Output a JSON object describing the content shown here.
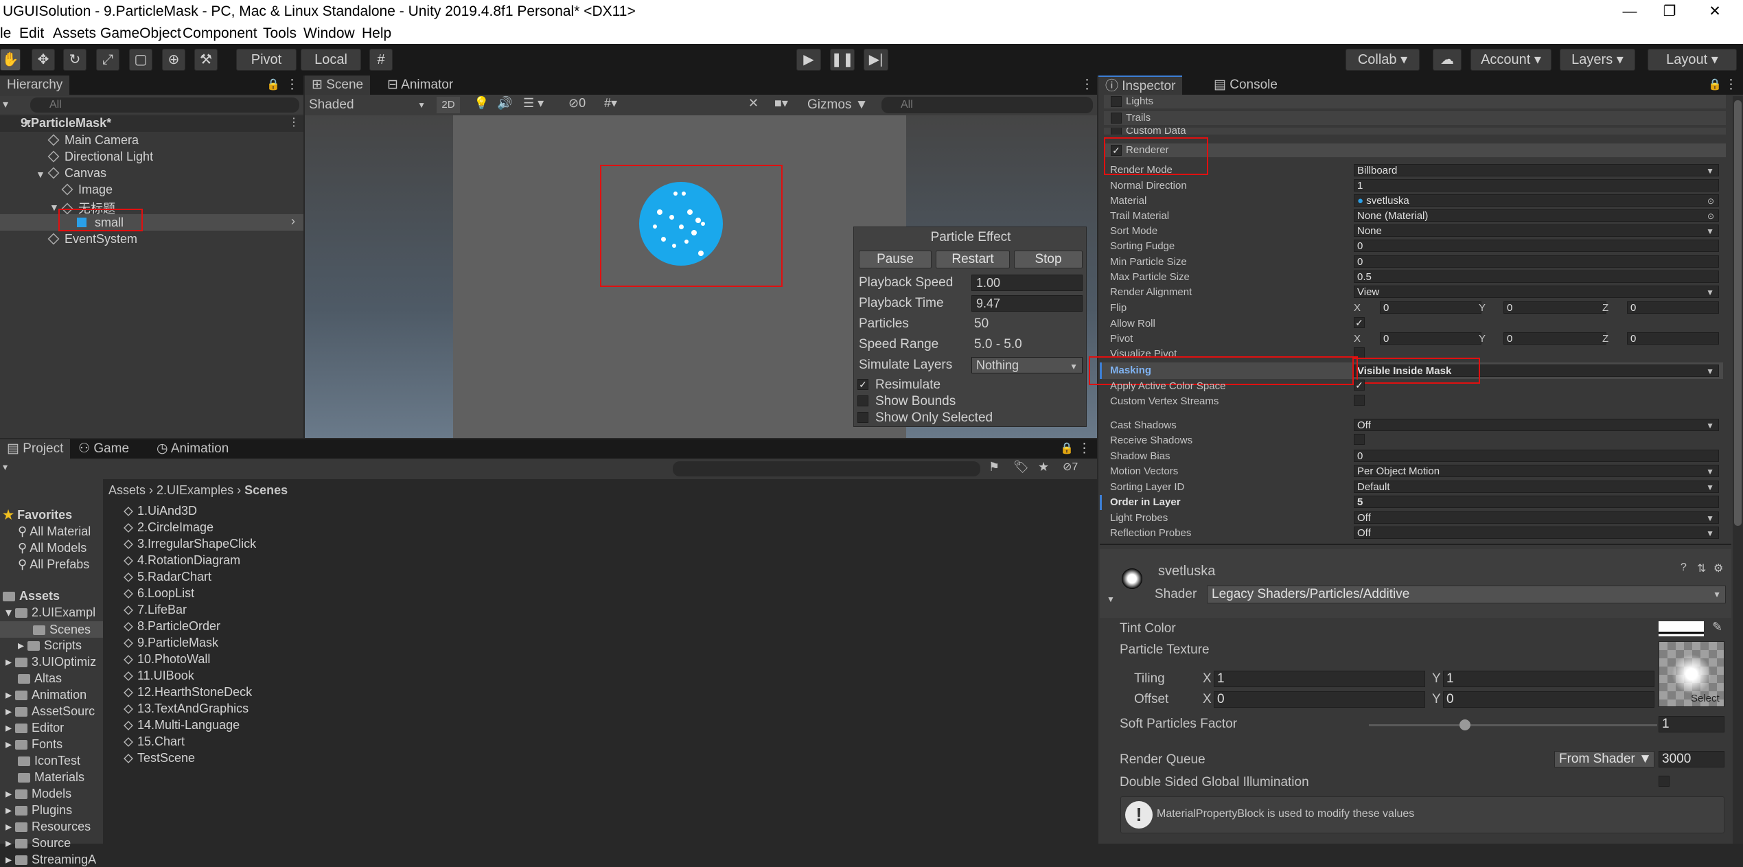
{
  "window": {
    "title": "UGUISolution - 9.ParticleMask - PC, Mac & Linux Standalone - Unity 2019.4.8f1 Personal* <DX11>",
    "minimize": "—",
    "maximize": "❐",
    "close": "✕"
  },
  "menu": [
    "le",
    "Edit",
    "Assets",
    "GameObject",
    "Component",
    "Tools",
    "Window",
    "Help"
  ],
  "toolbar": {
    "pivot_label": "Pivot",
    "local_label": "Local",
    "collab_label": "Collab",
    "account_label": "Account",
    "layers_label": "Layers",
    "layout_label": "Layout"
  },
  "hierarchy": {
    "tab": "Hierarchy",
    "search_placeholder": "All",
    "scene": "9.ParticleMask*",
    "items": [
      "Main Camera",
      "Directional Light",
      "Canvas",
      "Image",
      "无标题",
      "small",
      "EventSystem"
    ]
  },
  "scene_view": {
    "tabs": [
      "Scene",
      "Animator"
    ],
    "shading": "Shaded",
    "mode_2d": "2D",
    "hidden_count": "0",
    "gizmos": "Gizmos",
    "search_placeholder": "All"
  },
  "particle_effect": {
    "title": "Particle Effect",
    "buttons": [
      "Pause",
      "Restart",
      "Stop"
    ],
    "rows": [
      {
        "label": "Playback Speed",
        "value": "1.00"
      },
      {
        "label": "Playback Time",
        "value": "9.47"
      },
      {
        "label": "Particles",
        "value": "50"
      },
      {
        "label": "Speed Range",
        "value": "5.0 - 5.0"
      },
      {
        "label": "Simulate Layers",
        "value": "Nothing"
      }
    ],
    "toggles": [
      {
        "label": "Resimulate",
        "checked": true
      },
      {
        "label": "Show Bounds",
        "checked": false
      },
      {
        "label": "Show Only Selected",
        "checked": false
      }
    ]
  },
  "project": {
    "tabs": [
      "Project",
      "Game",
      "Animation"
    ],
    "hidden_count": "7",
    "breadcrumb": [
      "Assets",
      "2.UIExamples",
      "Scenes"
    ],
    "favorites_title": "Favorites",
    "favorites": [
      "All Material",
      "All Models",
      "All Prefabs"
    ],
    "assets_title": "Assets",
    "folders": [
      "2.UIExampl",
      "Scenes",
      "Scripts",
      "3.UIOptimiz",
      "Altas",
      "Animation",
      "AssetSourc",
      "Editor",
      "Fonts",
      "IconTest",
      "Materials",
      "Models",
      "Plugins",
      "Resources",
      "Source",
      "StreamingA"
    ],
    "scenes": [
      "1.UiAnd3D",
      "2.CircleImage",
      "3.IrregularShapeClick",
      "4.RotationDiagram",
      "5.RadarChart",
      "6.LoopList",
      "7.LifeBar",
      "8.ParticleOrder",
      "9.ParticleMask",
      "10.PhotoWall",
      "11.UIBook",
      "12.HearthStoneDeck",
      "13.TextAndGraphics",
      "14.Multi-Language",
      "15.Chart",
      "TestScene"
    ]
  },
  "inspector": {
    "tabs": [
      "Inspector",
      "Console"
    ],
    "modules": [
      {
        "label": "Lights",
        "checked": false
      },
      {
        "label": "Trails",
        "checked": false
      },
      {
        "label": "Custom Data",
        "checked": false
      },
      {
        "label": "Renderer",
        "checked": true
      }
    ],
    "renderer": {
      "render_mode": {
        "label": "Render Mode",
        "value": "Billboard"
      },
      "normal_direction": {
        "label": "Normal Direction",
        "value": "1"
      },
      "material": {
        "label": "Material",
        "value": "svetluska"
      },
      "trail_material": {
        "label": "Trail Material",
        "value": "None (Material)"
      },
      "sort_mode": {
        "label": "Sort Mode",
        "value": "None"
      },
      "sorting_fudge": {
        "label": "Sorting Fudge",
        "value": "0"
      },
      "min_particle_size": {
        "label": "Min Particle Size",
        "value": "0"
      },
      "max_particle_size": {
        "label": "Max Particle Size",
        "value": "0.5"
      },
      "render_alignment": {
        "label": "Render Alignment",
        "value": "View"
      },
      "flip": {
        "label": "Flip",
        "x": "0",
        "y": "0",
        "z": "0"
      },
      "allow_roll": {
        "label": "Allow Roll",
        "checked": true
      },
      "pivot": {
        "label": "Pivot",
        "x": "0",
        "y": "0",
        "z": "0"
      },
      "visualize_pivot": {
        "label": "Visualize Pivot",
        "checked": false
      },
      "masking": {
        "label": "Masking",
        "value": "Visible Inside Mask"
      },
      "apply_active_color_space": {
        "label": "Apply Active Color Space",
        "checked": true
      },
      "custom_vertex_streams": {
        "label": "Custom Vertex Streams",
        "checked": false
      },
      "cast_shadows": {
        "label": "Cast Shadows",
        "value": "Off"
      },
      "receive_shadows": {
        "label": "Receive Shadows",
        "checked": false
      },
      "shadow_bias": {
        "label": "Shadow Bias",
        "value": "0"
      },
      "motion_vectors": {
        "label": "Motion Vectors",
        "value": "Per Object Motion"
      },
      "sorting_layer_id": {
        "label": "Sorting Layer ID",
        "value": "Default"
      },
      "order_in_layer": {
        "label": "Order in Layer",
        "value": "5"
      },
      "light_probes": {
        "label": "Light Probes",
        "value": "Off"
      },
      "reflection_probes": {
        "label": "Reflection Probes",
        "value": "Off"
      }
    },
    "axis": {
      "x": "X",
      "y": "Y",
      "z": "Z"
    },
    "material": {
      "name": "svetluska",
      "shader_label": "Shader",
      "shader_value": "Legacy Shaders/Particles/Additive",
      "tint_color_label": "Tint Color",
      "particle_texture_label": "Particle Texture",
      "tiling_label": "Tiling",
      "tiling_x": "1",
      "tiling_y": "1",
      "offset_label": "Offset",
      "offset_x": "0",
      "offset_y": "0",
      "select_label": "Select",
      "soft_particles_label": "Soft Particles Factor",
      "soft_particles_value": "1",
      "render_queue_label": "Render Queue",
      "render_queue_mode": "From Shader",
      "render_queue_value": "3000",
      "double_sided_gi_label": "Double Sided Global Illumination",
      "info_message": "MaterialPropertyBlock is used to modify these values"
    }
  },
  "colors": {
    "accent_blue": "#3d7fd6",
    "highlight_red": "#e01010",
    "particle_blue": "#1aa8ec"
  }
}
